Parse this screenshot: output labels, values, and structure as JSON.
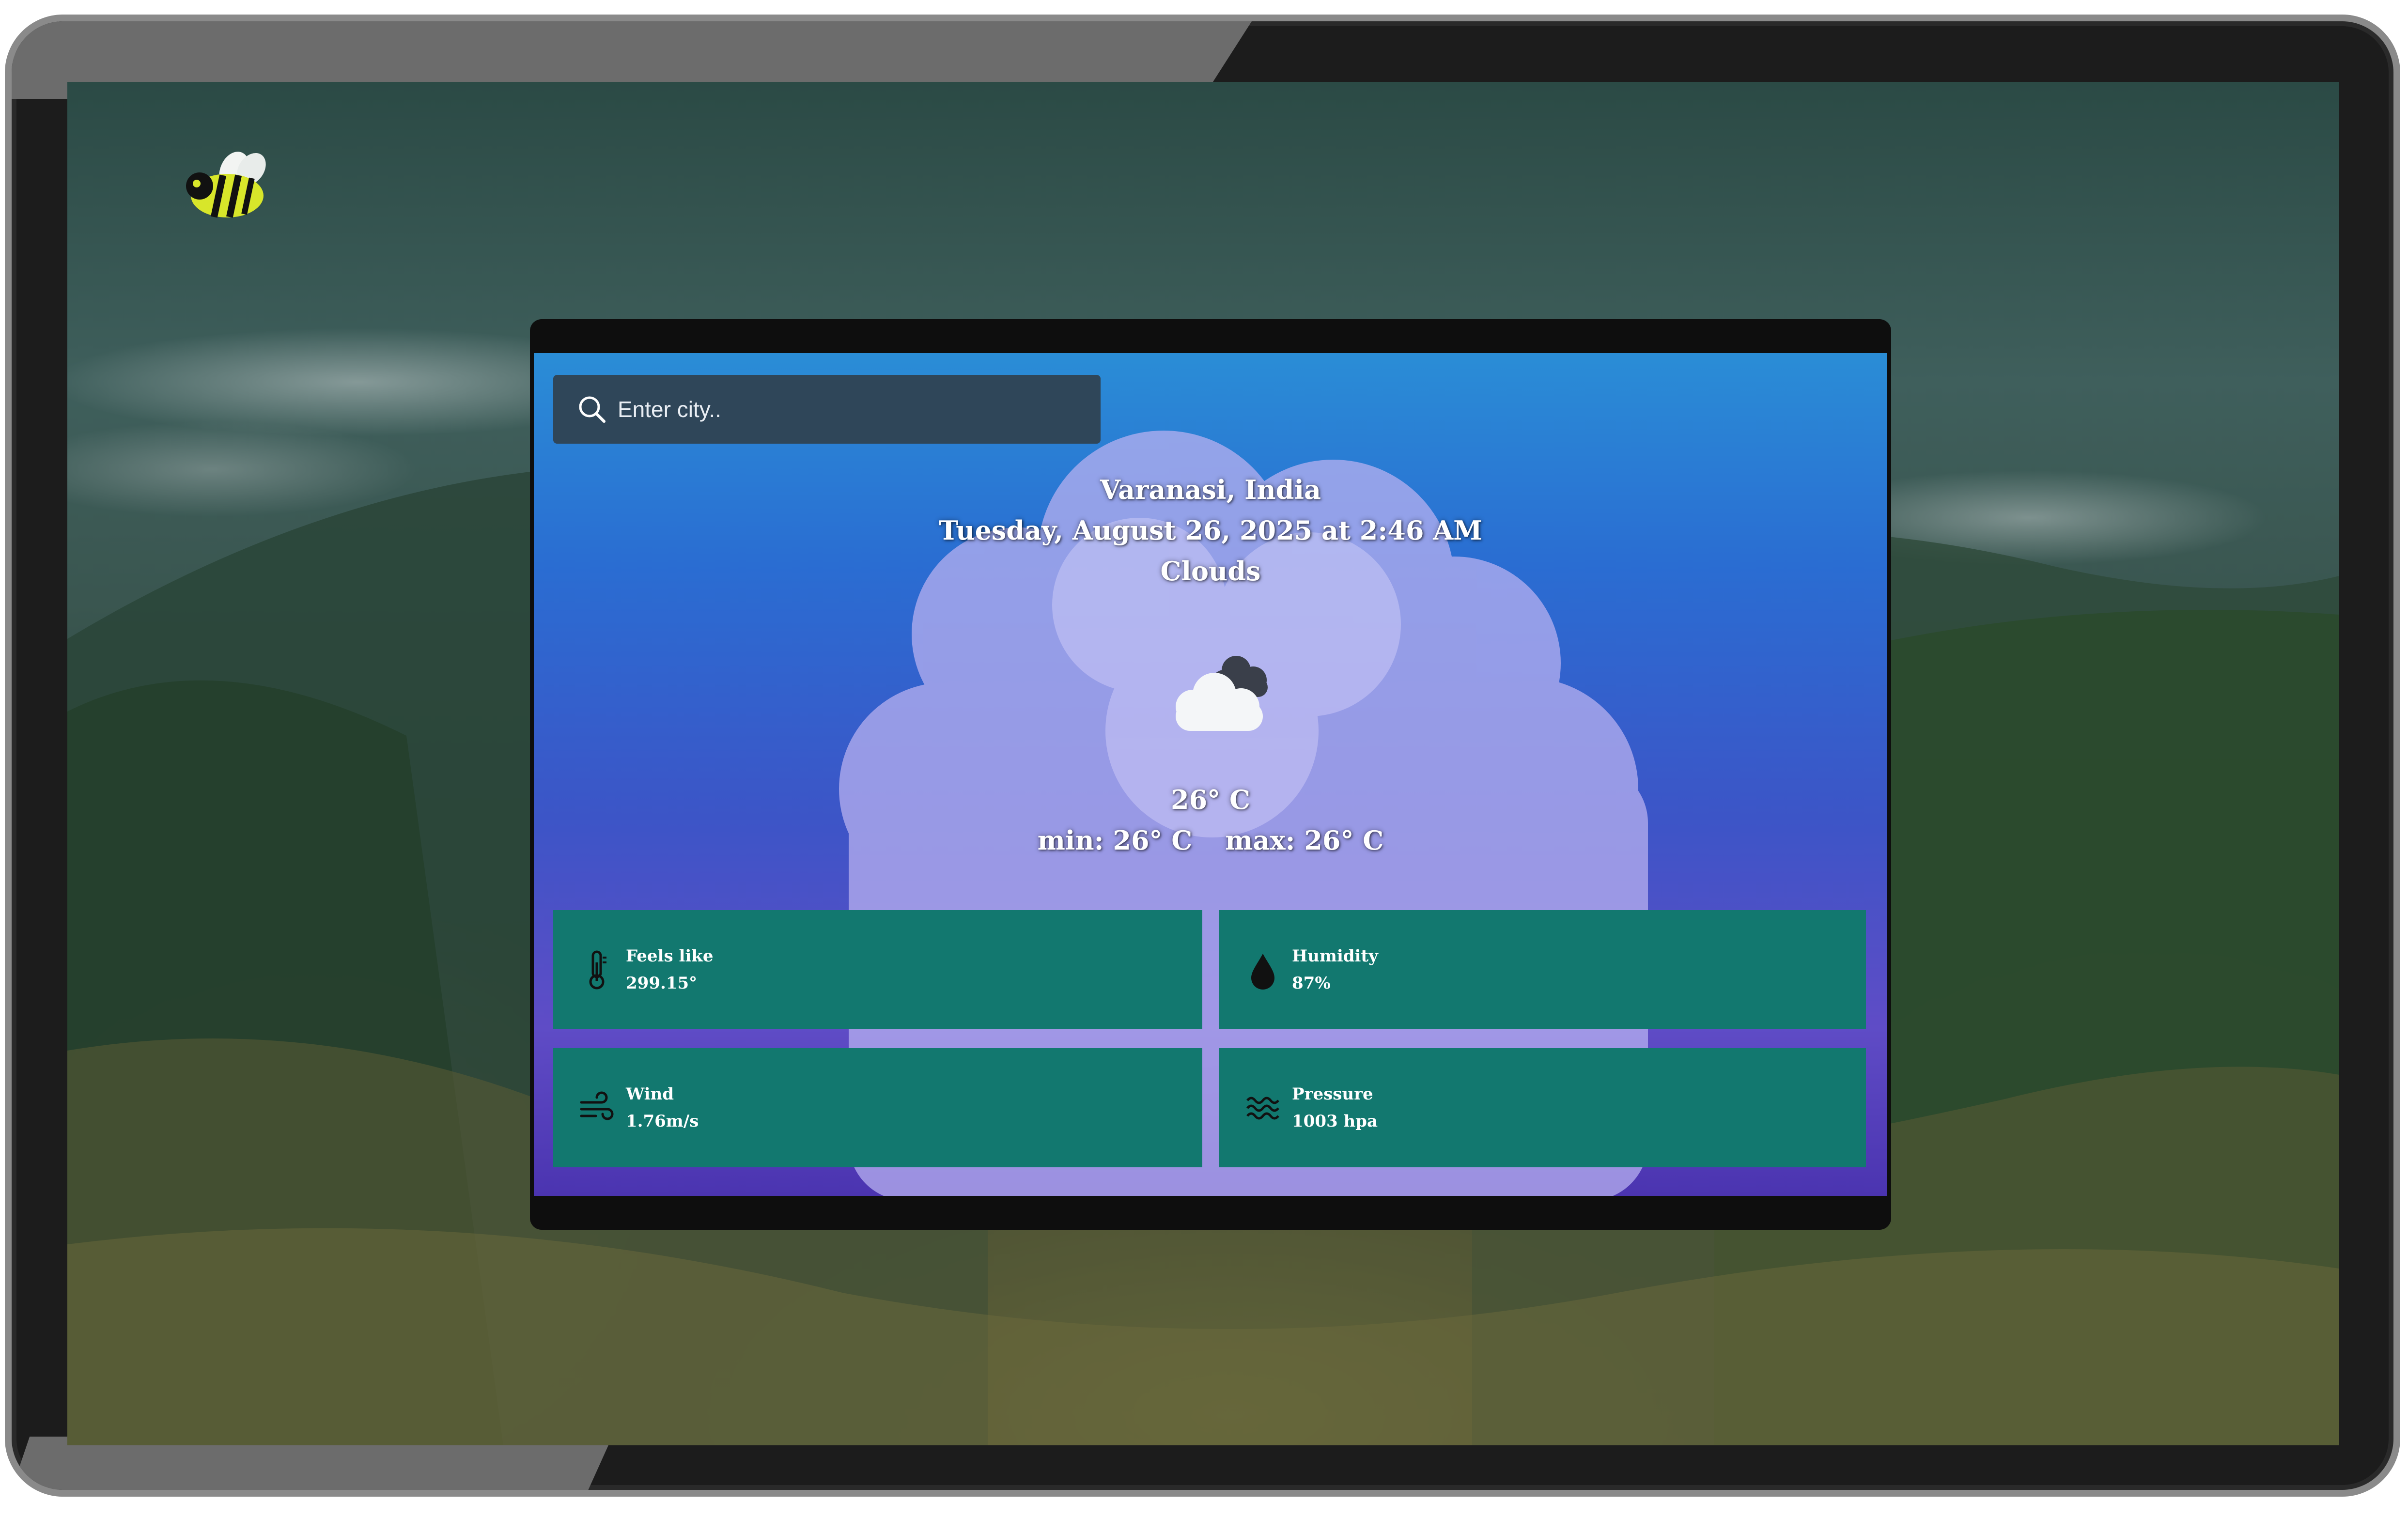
{
  "search": {
    "placeholder": "Enter city.."
  },
  "location": {
    "city_country": "Varanasi, India",
    "datetime": "Tuesday, August 26, 2025 at 2:46 AM",
    "condition": "Clouds"
  },
  "temperature": {
    "current": "26° C",
    "min": "min: 26° C",
    "max": "max: 26° C"
  },
  "details": {
    "feels_like": {
      "label": "Feels like",
      "value": "299.15°",
      "icon": "thermometer-icon"
    },
    "humidity": {
      "label": "Humidity",
      "value": "87%",
      "icon": "water-drop-icon"
    },
    "wind": {
      "label": "Wind",
      "value": "1.76m/s",
      "icon": "wind-icon"
    },
    "pressure": {
      "label": "Pressure",
      "value": "1003 hpa",
      "icon": "waves-icon"
    }
  },
  "colors": {
    "tile_background": "#12786f",
    "search_background": "#2f4659",
    "card_gradient_top": "#2a8dd6",
    "card_gradient_bottom": "#4b34b0"
  },
  "icons": {
    "logo": "bee-logo",
    "weather": "cloud-icon",
    "search": "search-icon"
  }
}
